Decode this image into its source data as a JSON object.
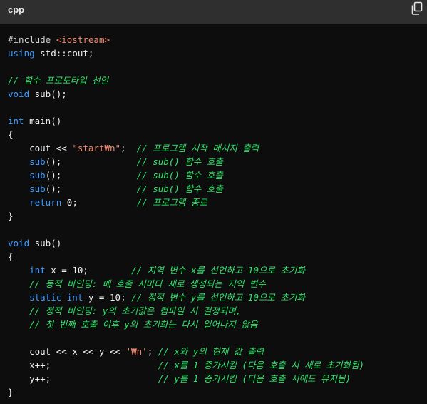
{
  "header": {
    "language": "cpp",
    "copy_icon": "copy-icon"
  },
  "code": {
    "lines": [
      [
        {
          "t": "pp",
          "v": "#include "
        },
        {
          "t": "str",
          "v": "<iostream>"
        }
      ],
      [
        {
          "t": "kw",
          "v": "using"
        },
        {
          "t": "id",
          "v": " std::cout;"
        }
      ],
      [],
      [
        {
          "t": "cm",
          "v": "// 함수 프로토타입 선언"
        }
      ],
      [
        {
          "t": "kw",
          "v": "void"
        },
        {
          "t": "id",
          "v": " sub();"
        }
      ],
      [],
      [
        {
          "t": "kw",
          "v": "int"
        },
        {
          "t": "id",
          "v": " main()"
        }
      ],
      [
        {
          "t": "op",
          "v": "{"
        }
      ],
      [
        {
          "t": "id",
          "v": "    cout << "
        },
        {
          "t": "str",
          "v": "\"start₩n\""
        },
        {
          "t": "id",
          "v": ";  "
        },
        {
          "t": "cm",
          "v": "// 프로그램 시작 메시지 출력"
        }
      ],
      [
        {
          "t": "kw",
          "v": "    sub"
        },
        {
          "t": "id",
          "v": "();              "
        },
        {
          "t": "cm",
          "v": "// sub() 함수 호출"
        }
      ],
      [
        {
          "t": "kw",
          "v": "    sub"
        },
        {
          "t": "id",
          "v": "();              "
        },
        {
          "t": "cm",
          "v": "// sub() 함수 호출"
        }
      ],
      [
        {
          "t": "kw",
          "v": "    sub"
        },
        {
          "t": "id",
          "v": "();              "
        },
        {
          "t": "cm",
          "v": "// sub() 함수 호출"
        }
      ],
      [
        {
          "t": "kw",
          "v": "    return"
        },
        {
          "t": "num",
          "v": " 0"
        },
        {
          "t": "id",
          "v": ";           "
        },
        {
          "t": "cm",
          "v": "// 프로그램 종료"
        }
      ],
      [
        {
          "t": "op",
          "v": "}"
        }
      ],
      [],
      [
        {
          "t": "kw",
          "v": "void"
        },
        {
          "t": "id",
          "v": " sub()"
        }
      ],
      [
        {
          "t": "op",
          "v": "{"
        }
      ],
      [
        {
          "t": "kw",
          "v": "    int"
        },
        {
          "t": "id",
          "v": " x = "
        },
        {
          "t": "num",
          "v": "10"
        },
        {
          "t": "id",
          "v": ";        "
        },
        {
          "t": "cm",
          "v": "// 지역 변수 x를 선언하고 10으로 초기화"
        }
      ],
      [
        {
          "t": "cm",
          "v": "    // 동적 바인딩: 매 호출 시마다 새로 생성되는 지역 변수"
        }
      ],
      [
        {
          "t": "kw",
          "v": "    static int"
        },
        {
          "t": "id",
          "v": " y = "
        },
        {
          "t": "num",
          "v": "10"
        },
        {
          "t": "id",
          "v": "; "
        },
        {
          "t": "cm",
          "v": "// 정적 변수 y를 선언하고 10으로 초기화"
        }
      ],
      [
        {
          "t": "cm",
          "v": "    // 정적 바인딩: y의 초기값은 컴파일 시 결정되며,"
        }
      ],
      [
        {
          "t": "cm",
          "v": "    // 첫 번째 호출 이후 y의 초기화는 다시 일어나지 않음"
        }
      ],
      [],
      [
        {
          "t": "id",
          "v": "    cout << x << y << "
        },
        {
          "t": "str",
          "v": "'₩n'"
        },
        {
          "t": "id",
          "v": "; "
        },
        {
          "t": "cm",
          "v": "// x와 y의 현재 값 출력"
        }
      ],
      [
        {
          "t": "id",
          "v": "    x++;                    "
        },
        {
          "t": "cm",
          "v": "// x를 1 증가시킴 (다음 호출 시 새로 초기화됨)"
        }
      ],
      [
        {
          "t": "id",
          "v": "    y++;                    "
        },
        {
          "t": "cm",
          "v": "// y를 1 증가시킴 (다음 호출 시에도 유지됨)"
        }
      ],
      [
        {
          "t": "op",
          "v": "}"
        }
      ]
    ]
  }
}
